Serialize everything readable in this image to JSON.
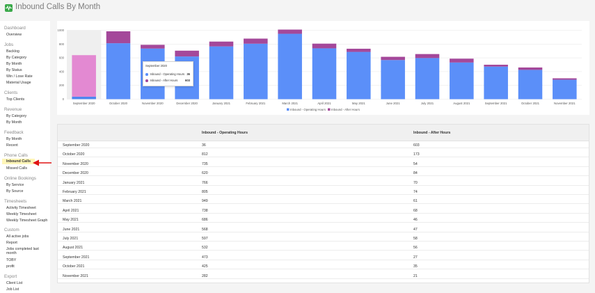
{
  "header": {
    "title": "Inbound Calls By Month"
  },
  "sidebar": {
    "sections": [
      {
        "title": "Dashboard",
        "items": [
          "Overview"
        ]
      },
      {
        "title": "Jobs",
        "items": [
          "Backlog",
          "By Category",
          "By Month",
          "By Status",
          "Win / Lose Rate",
          "Material Usage"
        ]
      },
      {
        "title": "Clients",
        "items": [
          "Top Clients"
        ]
      },
      {
        "title": "Revenue",
        "items": [
          "By Category",
          "By Month"
        ]
      },
      {
        "title": "Feedback",
        "items": [
          "By Month",
          "Recent"
        ]
      },
      {
        "title": "Phone Calls",
        "items": [
          "Inbound Calls",
          "Missed Calls"
        ]
      },
      {
        "title": "Online Bookings",
        "items": [
          "By Service",
          "By Source"
        ]
      },
      {
        "title": "Timesheets",
        "items": [
          "Activity Timesheet",
          "Weekly Timesheet",
          "Weekly Timesheet Graph"
        ]
      },
      {
        "title": "Custom",
        "items": [
          "All active jobs",
          "Report",
          "Jobs completed last month",
          "TOBY",
          "profit"
        ]
      },
      {
        "title": "Export",
        "items": [
          "Client List",
          "Job List"
        ]
      }
    ],
    "active_item": "Inbound Calls"
  },
  "tooltip": {
    "title": "September 2020",
    "rows": [
      {
        "label": "Inbound - Operating Hours",
        "value": "36"
      },
      {
        "label": "Inbound - After Hours",
        "value": "603"
      }
    ]
  },
  "colors": {
    "operating": "#5b8ff9",
    "after": "#a4489a",
    "after_highlight": "#e389d2",
    "operating_highlight": "#4f86f0"
  },
  "chart_data": {
    "type": "bar",
    "stacked": true,
    "categories": [
      "September 2020",
      "October 2020",
      "November 2020",
      "December 2020",
      "January 2021",
      "February 2021",
      "March 2021",
      "April 2021",
      "May 2021",
      "June 2021",
      "July 2021",
      "August 2021",
      "September 2021",
      "October 2021",
      "November 2021"
    ],
    "series": [
      {
        "name": "Inbound - Operating Hours",
        "values": [
          36,
          812,
          735,
          620,
          766,
          805,
          949,
          738,
          686,
          568,
          597,
          532,
          473,
          425,
          282
        ]
      },
      {
        "name": "Inbound - After Hours",
        "values": [
          603,
          173,
          54,
          84,
          70,
          74,
          61,
          68,
          46,
          47,
          58,
          56,
          27,
          35,
          21
        ]
      }
    ],
    "ylim": [
      0,
      1000
    ],
    "yticks": [
      "0",
      "200",
      "400",
      "600",
      "800",
      "1000"
    ],
    "highlighted_category": "September 2020",
    "legend": "bottom",
    "grid": true
  },
  "table": {
    "headers": [
      "",
      "Inbound - Operating Hours",
      "Inbound - After Hours"
    ],
    "rows": [
      [
        "September 2020",
        "36",
        "603"
      ],
      [
        "October 2020",
        "812",
        "173"
      ],
      [
        "November 2020",
        "735",
        "54"
      ],
      [
        "December 2020",
        "620",
        "84"
      ],
      [
        "January 2021",
        "766",
        "70"
      ],
      [
        "February 2021",
        "805",
        "74"
      ],
      [
        "March 2021",
        "949",
        "61"
      ],
      [
        "April 2021",
        "738",
        "68"
      ],
      [
        "May 2021",
        "686",
        "46"
      ],
      [
        "June 2021",
        "568",
        "47"
      ],
      [
        "July 2021",
        "597",
        "58"
      ],
      [
        "August 2021",
        "532",
        "56"
      ],
      [
        "September 2021",
        "473",
        "27"
      ],
      [
        "October 2021",
        "425",
        "35"
      ],
      [
        "November 2021",
        "282",
        "21"
      ]
    ]
  }
}
